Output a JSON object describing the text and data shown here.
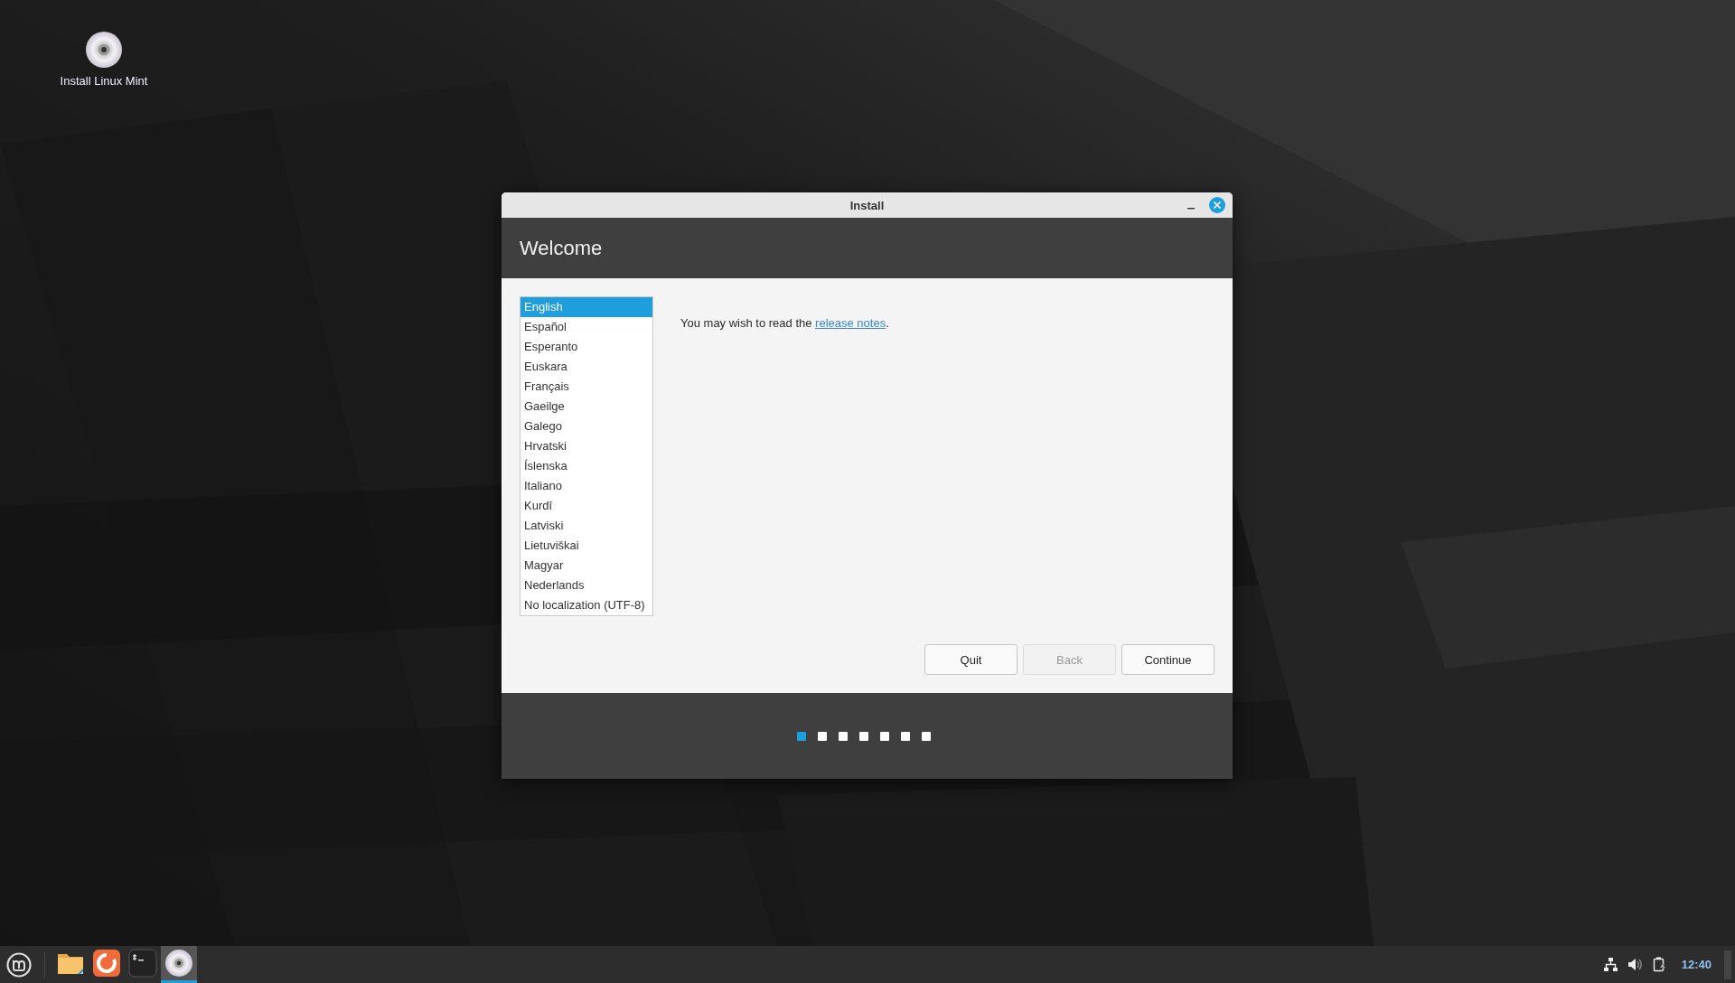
{
  "desktop": {
    "icons": [
      {
        "kind": "disc",
        "label": "Install Linux Mint"
      }
    ]
  },
  "window": {
    "title": "Install",
    "header": "Welcome",
    "languages": [
      {
        "label": "English",
        "selected": true
      },
      {
        "label": "Español",
        "selected": false
      },
      {
        "label": "Esperanto",
        "selected": false
      },
      {
        "label": "Euskara",
        "selected": false
      },
      {
        "label": "Français",
        "selected": false
      },
      {
        "label": "Gaeilge",
        "selected": false
      },
      {
        "label": "Galego",
        "selected": false
      },
      {
        "label": "Hrvatski",
        "selected": false
      },
      {
        "label": "Íslenska",
        "selected": false
      },
      {
        "label": "Italiano",
        "selected": false
      },
      {
        "label": "Kurdî",
        "selected": false
      },
      {
        "label": "Latviski",
        "selected": false
      },
      {
        "label": "Lietuviškai",
        "selected": false
      },
      {
        "label": "Magyar",
        "selected": false
      },
      {
        "label": "Nederlands",
        "selected": false
      },
      {
        "label": "No localization (UTF-8)",
        "selected": false
      }
    ],
    "message": {
      "before": "You may wish to read the ",
      "link": "release notes",
      "after": "."
    },
    "buttons": [
      {
        "label": "Quit",
        "disabled": false
      },
      {
        "label": "Back",
        "disabled": true
      },
      {
        "label": "Continue",
        "disabled": false
      }
    ],
    "steps": [
      {
        "selected": true
      },
      {
        "selected": false
      },
      {
        "selected": false
      },
      {
        "selected": false
      },
      {
        "selected": false
      },
      {
        "selected": false
      },
      {
        "selected": false
      }
    ]
  },
  "taskbar": {
    "launchers": [
      {
        "kind": "files",
        "active": false
      },
      {
        "kind": "browser",
        "active": false
      },
      {
        "kind": "terminal",
        "active": false
      },
      {
        "kind": "disc",
        "active": true
      }
    ],
    "tray": [
      {
        "kind": "network"
      },
      {
        "kind": "volume"
      },
      {
        "kind": "battery"
      }
    ],
    "clock": "12:40"
  }
}
